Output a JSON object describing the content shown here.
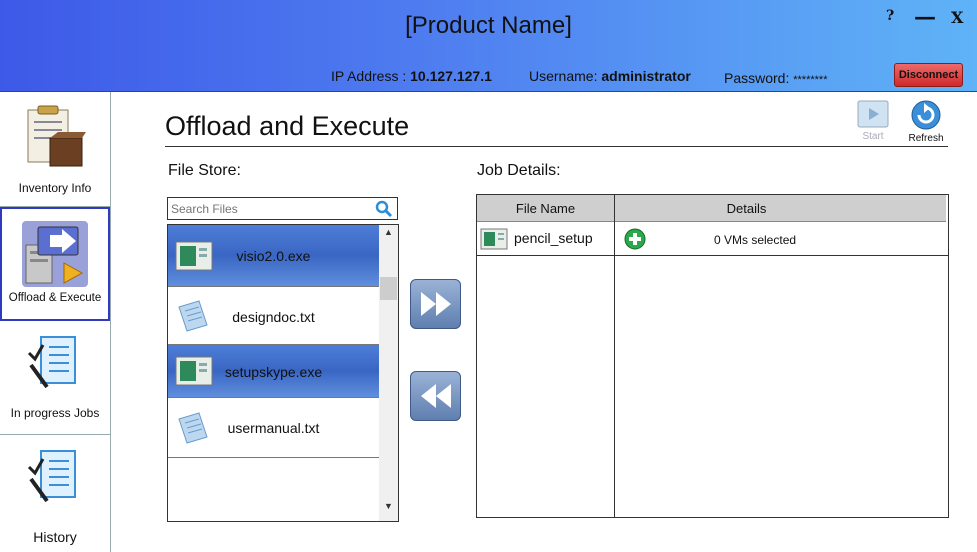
{
  "header": {
    "product_name": "[Product Name]",
    "help_label": "?",
    "minimize_label": "—",
    "close_label": "X",
    "ip_label": "IP Address : ",
    "ip_value": "10.127.127.1",
    "username_label": "Username: ",
    "username_value": "administrator",
    "password_label": "Password: ",
    "password_value": "********",
    "disconnect_label": "Disconnect"
  },
  "sidebar": {
    "items": [
      {
        "label": "Inventory Info",
        "icon": "clipboard-box-icon"
      },
      {
        "label": "Offload & Execute",
        "icon": "computer-arrow-icon",
        "active": true
      },
      {
        "label": "In progress Jobs",
        "icon": "checklist-pen-icon"
      },
      {
        "label": "History",
        "icon": "checklist-pen-icon"
      }
    ]
  },
  "main": {
    "title": "Offload and Execute",
    "start_label": "Start",
    "refresh_label": "Refresh",
    "file_store_label": "File Store:",
    "job_details_label": "Job Details:",
    "search_placeholder": "Search Files",
    "files": [
      {
        "name": "visio2.0.exe",
        "type": "exe",
        "selected": true
      },
      {
        "name": "designdoc.txt",
        "type": "txt",
        "selected": false
      },
      {
        "name": "setupskype.exe",
        "type": "exe",
        "selected": true
      },
      {
        "name": "usermanual.txt",
        "type": "txt",
        "selected": false
      }
    ],
    "job_table": {
      "col_file_name": "File Name",
      "col_details": "Details",
      "rows": [
        {
          "file_name": "pencil_setup",
          "details": "0 VMs selected"
        }
      ]
    }
  },
  "colors": {
    "header_start": "#3d59e8",
    "header_end": "#5fb3f7",
    "selected_row": "#4d7ed8",
    "disconnect": "#d83a3a",
    "active_border": "#2e3ac0"
  }
}
